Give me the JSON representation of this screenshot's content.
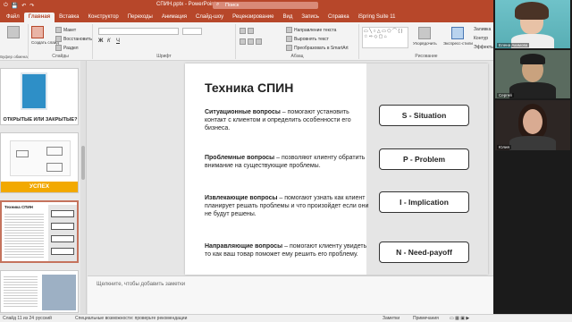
{
  "titlebar": {
    "document": "СПИН.pptx - PowerPoint",
    "search_placeholder": "Поиск"
  },
  "tabs": [
    "Файл",
    "Главная",
    "Вставка",
    "Конструктор",
    "Переходы",
    "Анимация",
    "Слайд-шоу",
    "Рецензирование",
    "Вид",
    "Запись",
    "Справка",
    "iSpring Suite 11"
  ],
  "active_tab": "Главная",
  "ribbon": {
    "create_slide": "Создать слайд",
    "layout": "Макет",
    "reset": "Восстановить",
    "section": "Раздел",
    "group_slides": "Слайды",
    "group_font": "Шрифт",
    "group_paragraph": "Абзац",
    "group_drawing": "Рисование",
    "text_direction": "Направление текста",
    "align_text": "Выровнять текст",
    "smartart": "Преобразовать в SmartArt",
    "arrange": "Упорядочить",
    "quick_styles": "Экспресс-стили",
    "fill": "Заливка",
    "outline": "Контур",
    "effects": "Эффекты",
    "clipboard_label": "Буфер обмена",
    "paste": "Вставить"
  },
  "thumbnails": [
    {
      "number": "",
      "caption": "ОТКРЫТЫЕ ИЛИ ЗАКРЫТЫЕ?"
    },
    {
      "number": "",
      "caption": "УСПЕХ"
    },
    {
      "number": "",
      "caption": "Техника СПИН"
    },
    {
      "number": "",
      "caption": ""
    }
  ],
  "slide": {
    "title": "Техника СПИН",
    "items": [
      {
        "term": "Ситуационные вопросы",
        "text": " – помогают установить контакт с клиентом и определить особенности его бизнеса.",
        "pill": "S - Situation"
      },
      {
        "term": "Проблемные вопросы",
        "text": " – позволяют клиенту обратить внимание на существующие проблемы.",
        "pill": "P - Problem"
      },
      {
        "term": "Извлекающие вопросы",
        "text": " – помогают узнать как клиент планирует решать проблемы и что произойдет если они не будут решены.",
        "pill": "I - Implication"
      },
      {
        "term": "Направляющие вопросы",
        "text": " – помогают клиенту увидеть то как ваш товар поможет ему решить его проблему.",
        "pill": "N - Need-payoff"
      }
    ]
  },
  "notes_placeholder": "Щелкните, чтобы добавить заметки",
  "statusbar": {
    "slide_of": "Слайд 11 из 24",
    "language": "русский",
    "accessibility": "Специальные возможности: проверьте рекомендации",
    "notes": "Заметки",
    "comments": "Примечания"
  },
  "participants": [
    {
      "name": "Елена Акимова"
    },
    {
      "name": "Сергей"
    },
    {
      "name": "Юлия"
    }
  ]
}
